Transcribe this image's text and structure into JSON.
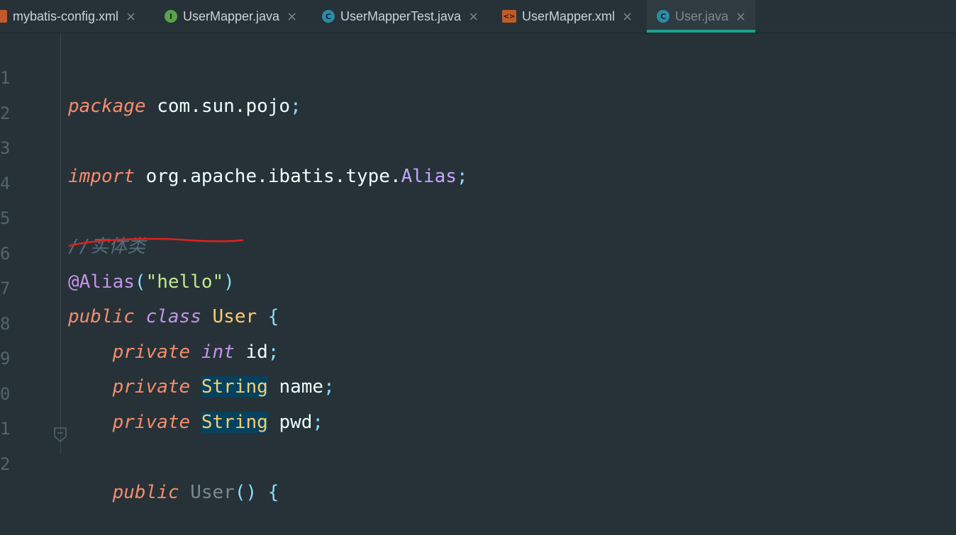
{
  "tabs": [
    {
      "label": "mybatis-config.xml",
      "icon": "xml-file-icon",
      "active": false
    },
    {
      "label": "UserMapper.java",
      "icon": "interface-icon",
      "active": false
    },
    {
      "label": "UserMapperTest.java",
      "icon": "class-icon",
      "active": false
    },
    {
      "label": "UserMapper.xml",
      "icon": "xml-file-icon",
      "active": false
    },
    {
      "label": "User.java",
      "icon": "class-icon",
      "active": true
    }
  ],
  "icons": {
    "interface": "I",
    "class": "C",
    "xml": "<>",
    "close": "×"
  },
  "line_numbers": [
    "1",
    "2",
    "3",
    "4",
    "5",
    "6",
    "7",
    "8",
    "9",
    "0",
    "1",
    "2"
  ],
  "code": {
    "l1": {
      "kw": "package",
      "pkg": "com.sun.pojo",
      "semi": ";"
    },
    "l3": {
      "kw": "import",
      "pkg": "org.apache.ibatis.type.",
      "cls": "Alias",
      "semi": ";"
    },
    "l5": {
      "comment": "//实体类"
    },
    "l6": {
      "ann": "@Alias",
      "open": "(",
      "str": "\"hello\"",
      "close": ")"
    },
    "l7": {
      "kw1": "public",
      "kw2": "class",
      "cls": "User",
      "brace": "{"
    },
    "l8": {
      "kw1": "private",
      "kw2": "int",
      "name": "id",
      "semi": ";"
    },
    "l9": {
      "kw1": "private",
      "type": "String",
      "name": "name",
      "semi": ";"
    },
    "l10": {
      "kw1": "private",
      "type": "String",
      "name": "pwd",
      "semi": ";"
    },
    "l12": {
      "kw1": "public",
      "cls": "User",
      "parens": "()",
      "brace": "{"
    }
  },
  "colors": {
    "background": "#263238",
    "active_tab_underline": "#19a38f",
    "annotation_underline": "#e02020",
    "selection_highlight": "#05425f"
  }
}
